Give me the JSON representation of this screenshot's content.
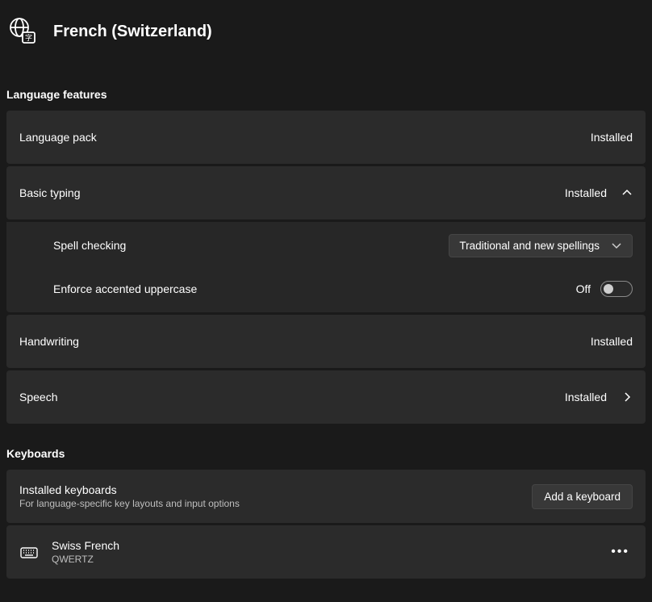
{
  "header": {
    "title": "French (Switzerland)"
  },
  "sections": {
    "features_label": "Language features",
    "keyboards_label": "Keyboards"
  },
  "features": {
    "language_pack": {
      "title": "Language pack",
      "status": "Installed"
    },
    "basic_typing": {
      "title": "Basic typing",
      "status": "Installed"
    },
    "spell_checking": {
      "title": "Spell checking",
      "dropdown_value": "Traditional and new spellings"
    },
    "accented_uppercase": {
      "title": "Enforce accented uppercase",
      "toggle_label": "Off"
    },
    "handwriting": {
      "title": "Handwriting",
      "status": "Installed"
    },
    "speech": {
      "title": "Speech",
      "status": "Installed"
    }
  },
  "keyboards": {
    "installed_title": "Installed keyboards",
    "installed_subtitle": "For language-specific key layouts and input options",
    "add_button": "Add a keyboard",
    "items": [
      {
        "name": "Swiss French",
        "layout": "QWERTZ"
      }
    ]
  }
}
